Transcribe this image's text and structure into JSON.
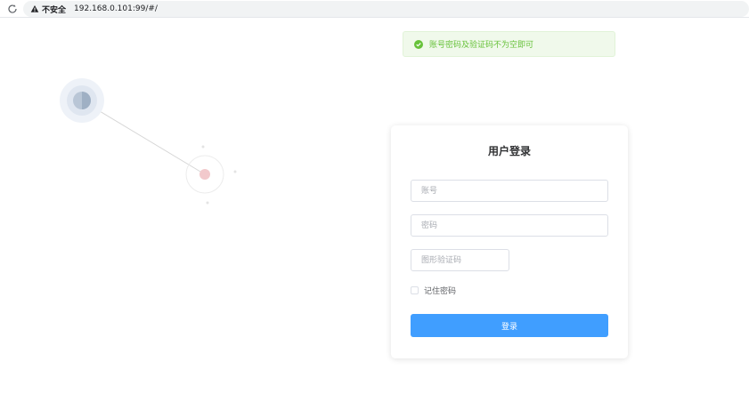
{
  "browser": {
    "security_label": "不安全",
    "url": "192.168.0.101:99/#/"
  },
  "toast": {
    "message": "账号密码及验证码不为空即可",
    "color": "#67c23a"
  },
  "login": {
    "title": "用户登录",
    "account_placeholder": "账号",
    "password_placeholder": "密码",
    "captcha_placeholder": "图形验证码",
    "remember_label": "记住密码",
    "remember_checked": false,
    "submit_label": "登录",
    "accent_color": "#409eff"
  }
}
